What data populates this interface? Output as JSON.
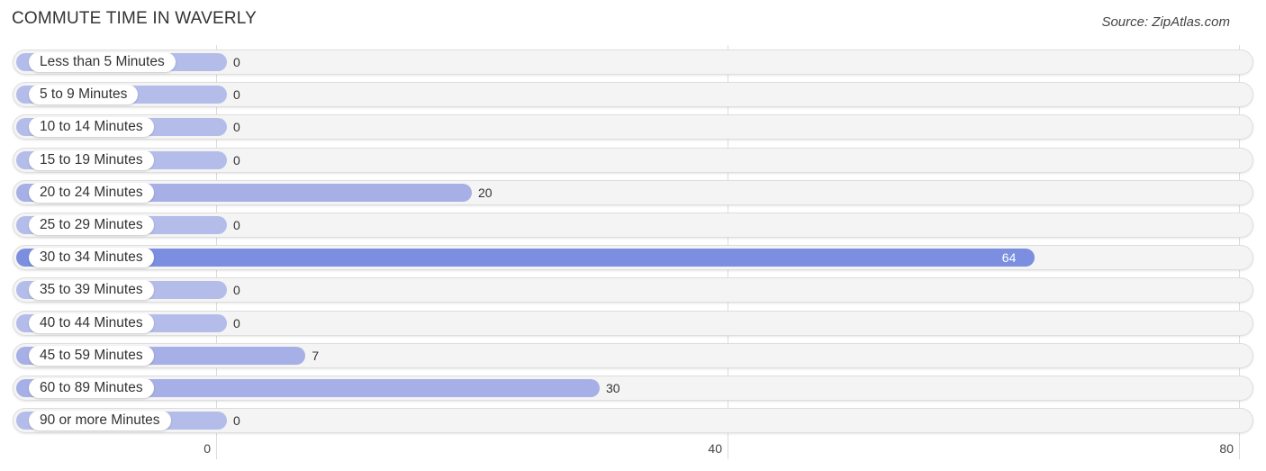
{
  "header": {
    "title": "COMMUTE TIME IN WAVERLY",
    "source": "Source: ZipAtlas.com"
  },
  "chart_data": {
    "type": "bar",
    "orientation": "horizontal",
    "title": "COMMUTE TIME IN WAVERLY",
    "source": "Source: ZipAtlas.com",
    "categories": [
      "Less than 5 Minutes",
      "5 to 9 Minutes",
      "10 to 14 Minutes",
      "15 to 19 Minutes",
      "20 to 24 Minutes",
      "25 to 29 Minutes",
      "30 to 34 Minutes",
      "35 to 39 Minutes",
      "40 to 44 Minutes",
      "45 to 59 Minutes",
      "60 to 89 Minutes",
      "90 or more Minutes"
    ],
    "values": [
      0,
      0,
      0,
      0,
      20,
      0,
      64,
      0,
      0,
      7,
      30,
      0
    ],
    "value_labels": [
      "0",
      "0",
      "0",
      "0",
      "20",
      "0",
      "64",
      "0",
      "0",
      "7",
      "30",
      "0"
    ],
    "xlabel": "",
    "ylabel": "",
    "xlim": [
      0,
      80
    ],
    "xticks": [
      0,
      40,
      80
    ],
    "xtick_labels": [
      "0",
      "40",
      "80"
    ],
    "grid": true,
    "legend": "none",
    "colors": {
      "bar_light": "#b4bdea",
      "bar_max": "#7b8ee0",
      "track": "#f4f4f4",
      "grid": "#dcdcdc"
    }
  }
}
